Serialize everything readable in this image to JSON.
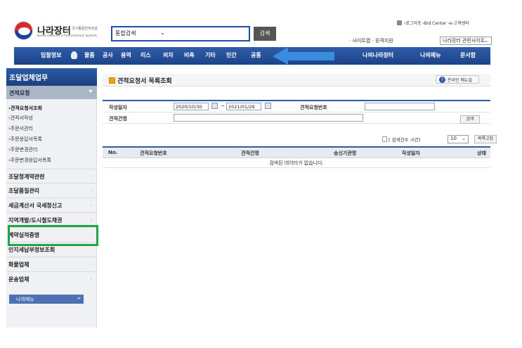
{
  "header": {
    "logo_title": "나라장터",
    "logo_subtitle": "국가종합전자조달",
    "logo_english": "Korea ON-Line E-Procurement System",
    "search_scope": "통합검색",
    "search_button": "검색",
    "top_links": "›로그아웃 ›Bid Center ›e-고객센터",
    "site_links": "· 사이트맵 · 원격지원",
    "site_select": "나라장터 관련사이트"
  },
  "nav": {
    "items": [
      "입찰정보",
      "물품",
      "공사",
      "용역",
      "리스",
      "외자",
      "비축",
      "기타",
      "민간",
      "공통"
    ],
    "right_items": [
      "나의나라장터",
      "나의메뉴",
      "문서함"
    ]
  },
  "sidebar": {
    "title": "조달업체업무",
    "section": "견적요청",
    "subitems": [
      "›견적요청서조회",
      "›견적서작성",
      "›주문서관리",
      "›주문응답서목록",
      "›주문변경관리",
      "›주문변경응답서목록"
    ],
    "categories": [
      "조달청계약관련",
      "조달품질관리",
      "세금계산서 국세청신고",
      "지역개발/도시철도채권",
      "계약실적증명",
      "인지세납부정보조회",
      "화물업체",
      "운송업체"
    ],
    "my_menu": "나의메뉴",
    "my_menu_toggle": "∞"
  },
  "main": {
    "title": "견적요청서 목록조회",
    "manual_button": "온라인 매뉴얼",
    "form": {
      "date_label": "작성일자",
      "date_from": "2020/10/30",
      "date_sep": "~",
      "date_to": "2021/01/29",
      "number_label": "견적요청번호",
      "name_label": "견적건명",
      "search_button": "검색"
    },
    "count_text": "[ 검색건수 :0건]",
    "page_size": "10",
    "list_button": "목록고침",
    "table": {
      "headers": [
        "No.",
        "견적요청번호",
        "견적건명",
        "송신기관명",
        "작성일자",
        "상태"
      ],
      "empty_message": "검색된 데이터가 없습니다."
    }
  },
  "colors": {
    "nav_blue": "#2f5da8",
    "highlight_green": "#22a44b",
    "arrow_blue": "#3b8fe0"
  }
}
